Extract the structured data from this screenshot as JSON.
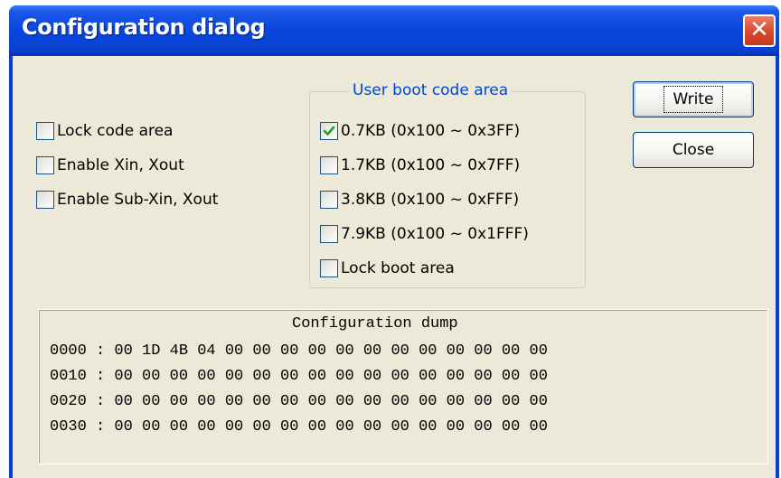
{
  "window": {
    "title": "Configuration dialog",
    "close_glyph": "✕"
  },
  "options": {
    "lock_code_area": {
      "label": "Lock code area",
      "checked": false
    },
    "enable_xin_xout": {
      "label": "Enable Xin, Xout",
      "checked": false
    },
    "enable_sub_xin_xout": {
      "label": "Enable Sub-Xin, Xout",
      "checked": false
    }
  },
  "boot_group": {
    "title": "User boot code area",
    "items": [
      {
        "label": "0.7KB (0x100 ~ 0x3FF)",
        "checked": true
      },
      {
        "label": "1.7KB (0x100 ~ 0x7FF)",
        "checked": false
      },
      {
        "label": "3.8KB (0x100 ~ 0xFFF)",
        "checked": false
      },
      {
        "label": "7.9KB (0x100 ~ 0x1FFF)",
        "checked": false
      }
    ],
    "lock_boot": {
      "label": "Lock boot area",
      "checked": false
    }
  },
  "buttons": {
    "write": "Write",
    "close": "Close"
  },
  "dump": {
    "title": "Configuration dump",
    "lines": [
      "0000 : 00 1D 4B 04 00 00 00 00 00 00 00 00 00 00 00 00",
      "0010 : 00 00 00 00 00 00 00 00 00 00 00 00 00 00 00 00",
      "0020 : 00 00 00 00 00 00 00 00 00 00 00 00 00 00 00 00",
      "0030 : 00 00 00 00 00 00 00 00 00 00 00 00 00 00 00 00"
    ]
  },
  "colors": {
    "titlebar": "#0a46dc",
    "dialog_bg": "#ece9d8",
    "group_title": "#0046d5",
    "checkmark": "#21a121",
    "close_button": "#d8482a"
  }
}
